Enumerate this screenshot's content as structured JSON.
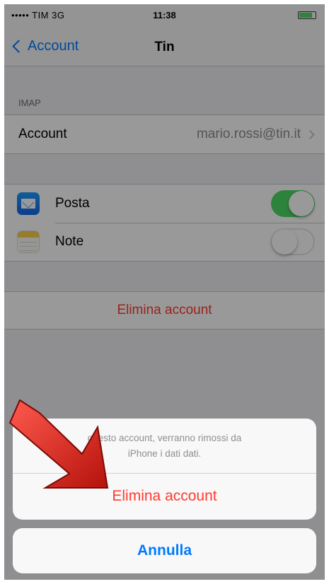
{
  "status_bar": {
    "carrier": "••••• TIM  3G",
    "time": "11:38"
  },
  "nav": {
    "back_label": "Account",
    "title": "Tin"
  },
  "imap_section": {
    "header": "IMAP",
    "account_label": "Account",
    "account_value": "mario.rossi@tin.it"
  },
  "services": [
    {
      "label": "Posta",
      "icon": "mail-icon",
      "enabled": true
    },
    {
      "label": "Note",
      "icon": "notes-icon",
      "enabled": false
    }
  ],
  "delete_row_label": "Elimina account",
  "action_sheet": {
    "message_line1": "questo account, verranno rimossi da",
    "message_line2": "iPhone i dati dati.",
    "delete_label": "Elimina account",
    "cancel_label": "Annulla"
  },
  "colors": {
    "accent": "#007aff",
    "destructive": "#ff3b30",
    "toggle_on": "#4cd964",
    "arrow": "#d8261e"
  }
}
